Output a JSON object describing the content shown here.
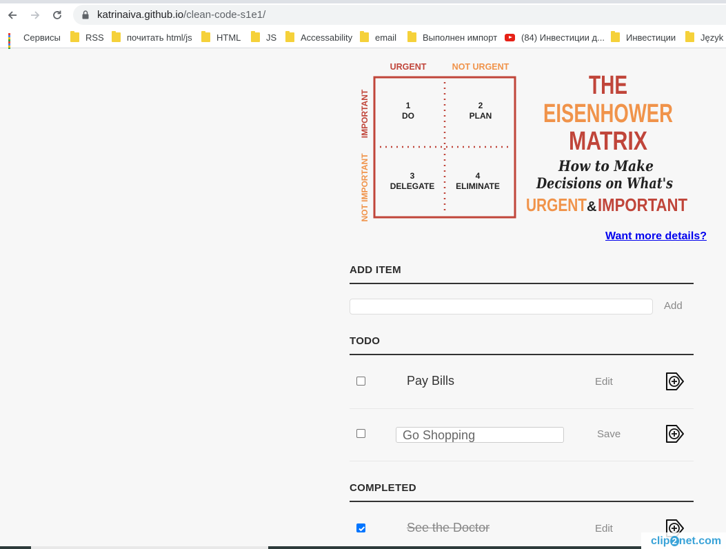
{
  "browser": {
    "back_icon": "arrow-left-icon",
    "forward_icon": "arrow-right-icon",
    "reload_icon": "reload-icon",
    "url_host": "katrinaiva.github.io",
    "url_path": "/clean-code-s1e1/"
  },
  "bookmarks": [
    {
      "label": "Сервисы",
      "icon": "apps-grid-icon"
    },
    {
      "label": "RSS",
      "icon": "folder-icon"
    },
    {
      "label": "почитать html/js",
      "icon": "folder-icon"
    },
    {
      "label": "HTML",
      "icon": "folder-icon"
    },
    {
      "label": "JS",
      "icon": "folder-icon"
    },
    {
      "label": "Accessability",
      "icon": "folder-icon"
    },
    {
      "label": "email",
      "icon": "folder-icon"
    },
    {
      "label": "Выполнен импорт",
      "icon": "folder-icon"
    },
    {
      "label": "(84) Инвестиции д...",
      "icon": "youtube-icon"
    },
    {
      "label": "Инвестиции",
      "icon": "folder-icon"
    },
    {
      "label": "Język P",
      "icon": "folder-icon"
    }
  ],
  "matrix": {
    "col_urgent": "URGENT",
    "col_not_urgent": "NOT URGENT",
    "row_important": "IMPORTANT",
    "row_not_important": "NOT IMPORTANT",
    "q1_num": "1",
    "q1_label": "DO",
    "q2_num": "2",
    "q2_label": "PLAN",
    "q3_num": "3",
    "q3_label": "DELEGATE",
    "q4_num": "4",
    "q4_label": "ELIMINATE",
    "title_the": "THE",
    "title_eisenhower": "EISENHOWER",
    "title_matrix": "MATRIX",
    "subtitle_line1": "How to Make",
    "subtitle_line2": "Decisions on What's",
    "subtitle_urgent": "URGENT",
    "subtitle_amp": "&",
    "subtitle_important": "IMPORTANT",
    "colors": {
      "red": "#c0453a",
      "orange": "#f0934a",
      "dark": "#222222"
    }
  },
  "more_details_link": "Want more details?",
  "add_item": {
    "title": "ADD ITEM",
    "input_value": "",
    "button_label": "Add"
  },
  "todo": {
    "title": "TODO",
    "items": [
      {
        "label": "Pay Bills",
        "checked": false,
        "editing": false,
        "action": "Edit",
        "icon": "tag-plus-icon"
      },
      {
        "label": "Go Shopping",
        "checked": false,
        "editing": true,
        "action": "Save",
        "icon": "tag-plus-icon"
      }
    ]
  },
  "completed": {
    "title": "COMPLETED",
    "items": [
      {
        "label": "See the Doctor",
        "checked": true,
        "editing": false,
        "action": "Edit",
        "icon": "tag-plus-icon"
      }
    ]
  },
  "watermark": {
    "pre": "clip",
    "two": "2",
    "post": "net.com"
  },
  "colors": {
    "link": "#0000ee",
    "checkbox_checked": "#0075ff",
    "heading_rule": "#333333"
  }
}
